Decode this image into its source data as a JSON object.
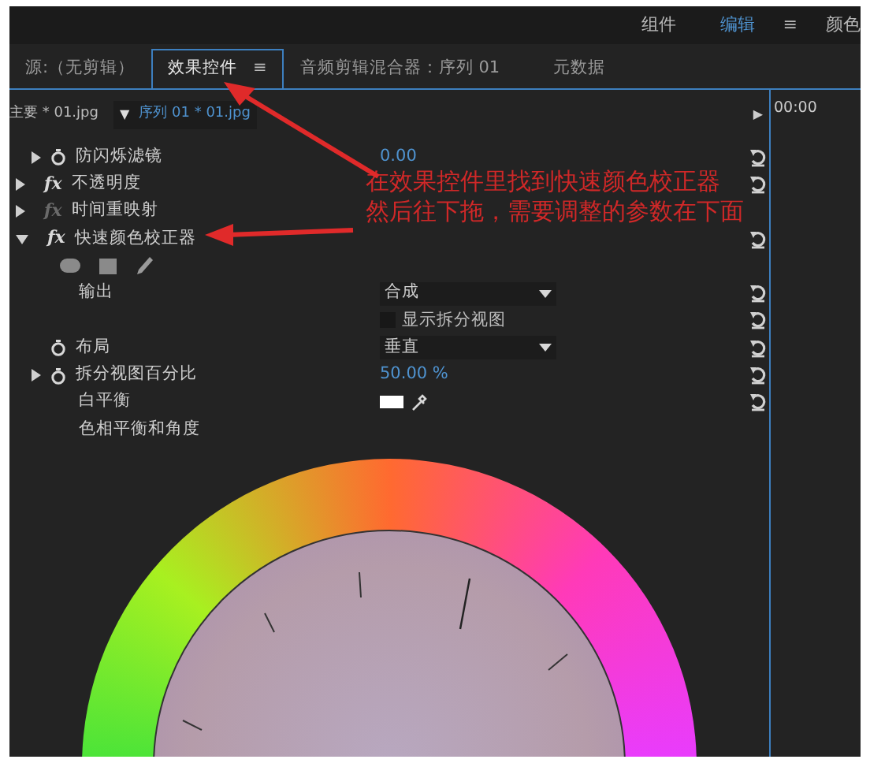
{
  "header": {
    "items": [
      {
        "label": "组件",
        "selected": false
      },
      {
        "label": "编辑",
        "selected": true
      },
      {
        "label": "≡",
        "selected": false
      },
      {
        "label": "颜色",
        "selected": false
      }
    ]
  },
  "tabs": [
    {
      "label": "源:（无剪辑）",
      "selected": false
    },
    {
      "label": "效果控件",
      "selected": true,
      "menu": "≡"
    },
    {
      "label": "音频剪辑混合器：序列 01",
      "selected": false
    },
    {
      "label": "元数据",
      "selected": false
    }
  ],
  "clip_bar": {
    "master": "主要 * 01.jpg",
    "caret": "▼",
    "sequence": "序列 01 * 01.jpg",
    "play": "▶",
    "timecode": "00:00"
  },
  "rows": [
    {
      "kind": "param",
      "label": "防闪烁滤镜",
      "toggle": true,
      "expanded": false,
      "stopwatch": true,
      "value": "0.00",
      "reset": true
    },
    {
      "kind": "effect",
      "badge": "fx",
      "label": "不透明度",
      "toggle": true,
      "expanded": false,
      "enabled": true,
      "reset": true
    },
    {
      "kind": "effect",
      "badge": "fx",
      "label": "时间重映射",
      "toggle": true,
      "expanded": false,
      "enabled": false,
      "reset": false
    },
    {
      "kind": "effect",
      "badge": "fx",
      "label": "快速颜色校正器",
      "toggle": true,
      "expanded": true,
      "enabled": true,
      "reset": true
    },
    {
      "kind": "masks"
    },
    {
      "kind": "dropdown",
      "label": "输出",
      "stopwatch": false,
      "value": "合成",
      "reset": true
    },
    {
      "kind": "checkbox",
      "label": "显示拆分视图",
      "checked": false,
      "reset": true
    },
    {
      "kind": "dropdown",
      "label": "布局",
      "stopwatch": true,
      "value": "垂直",
      "reset": true
    },
    {
      "kind": "param",
      "label": "拆分视图百分比",
      "toggle": true,
      "expanded": false,
      "stopwatch": true,
      "value": "50.00 %",
      "reset": true
    },
    {
      "kind": "swatch",
      "label": "白平衡",
      "reset": true
    },
    {
      "kind": "heading",
      "label": "色相平衡和角度"
    }
  ],
  "annotation": {
    "lines": [
      "在效果控件里找到快速颜色校正器",
      "然后往下拖，需要调整的参数在下面"
    ]
  }
}
